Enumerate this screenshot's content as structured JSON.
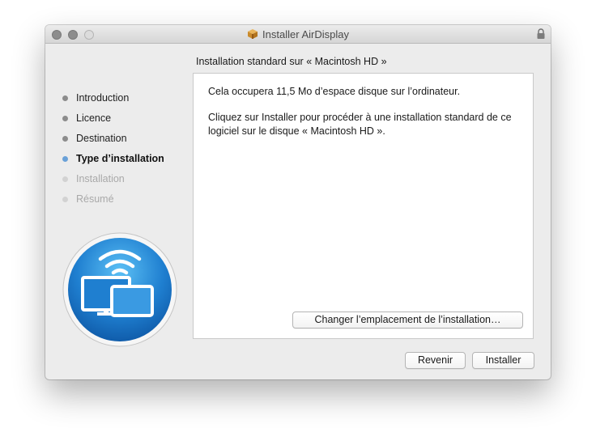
{
  "window": {
    "title": "Installer AirDisplay",
    "icons": {
      "title_icon": "package-icon",
      "lock_icon": "lock-icon"
    }
  },
  "header": {
    "subtitle": "Installation standard sur « Macintosh HD »"
  },
  "sidebar": {
    "steps": [
      {
        "label": "Introduction",
        "state": "done"
      },
      {
        "label": "Licence",
        "state": "done"
      },
      {
        "label": "Destination",
        "state": "done"
      },
      {
        "label": "Type d’installation",
        "state": "current"
      },
      {
        "label": "Installation",
        "state": "future"
      },
      {
        "label": "Résumé",
        "state": "future"
      }
    ]
  },
  "content": {
    "line1": "Cela occupera 11,5 Mo d’espace disque sur l’ordinateur.",
    "line2": "Cliquez sur Installer pour procéder à une installation standard de ce logiciel sur le disque « Macintosh HD ».",
    "change_location_label": "Changer l’emplacement de l’installation…"
  },
  "footer": {
    "back_label": "Revenir",
    "install_label": "Installer"
  },
  "colors": {
    "current_step_dot": "#6aa1d8",
    "logo_blue": "#1f7fd0"
  }
}
